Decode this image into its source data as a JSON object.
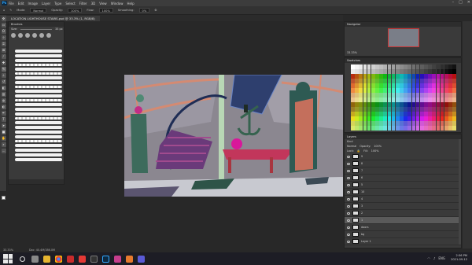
{
  "app": {
    "logo": "Ps",
    "menu": [
      "File",
      "Edit",
      "Image",
      "Layer",
      "Type",
      "Select",
      "Filter",
      "3D",
      "View",
      "Window",
      "Help"
    ],
    "window_controls": [
      "–",
      "□",
      "✕"
    ]
  },
  "options": {
    "mode_label": "Mode:",
    "mode": "Normal",
    "opacity_label": "Opacity:",
    "opacity": "100%",
    "flow_label": "Flow:",
    "flow": "100%",
    "smoothing_label": "Smoothing:",
    "smoothing": "0%"
  },
  "document_tab": "LOCATION LIGHTHOUSE STAIRS.psd @ 33.3% (1, RGB/8)",
  "brushes": {
    "title": "Brushes",
    "size_label": "Size:",
    "size": "33 px"
  },
  "navigator": {
    "title": "Navigator",
    "zoom": "33.33%"
  },
  "swatches": {
    "title": "Swatches"
  },
  "layers": {
    "title": "Layers",
    "kind_label": "Kind",
    "blend": "Normal",
    "opacity_label": "Opacity:",
    "opacity": "100%",
    "lock_label": "Lock:",
    "fill_label": "Fill:",
    "fill": "100%",
    "items": [
      "9",
      "8",
      "7",
      "6",
      "5",
      "10",
      "4",
      "3",
      "2",
      "1",
      "doors",
      "bg",
      "Layer 1"
    ]
  },
  "status": {
    "zoom": "33.33%",
    "doc": "Doc: 40.4M/386.0M"
  },
  "taskbar": {
    "lang": "ENG",
    "time": "2:56 PM",
    "date": "2021-09-12"
  },
  "colors": {
    "accent": "#31a8ff",
    "canvas_bg": "#282828",
    "panel": "#3a3a3a"
  }
}
